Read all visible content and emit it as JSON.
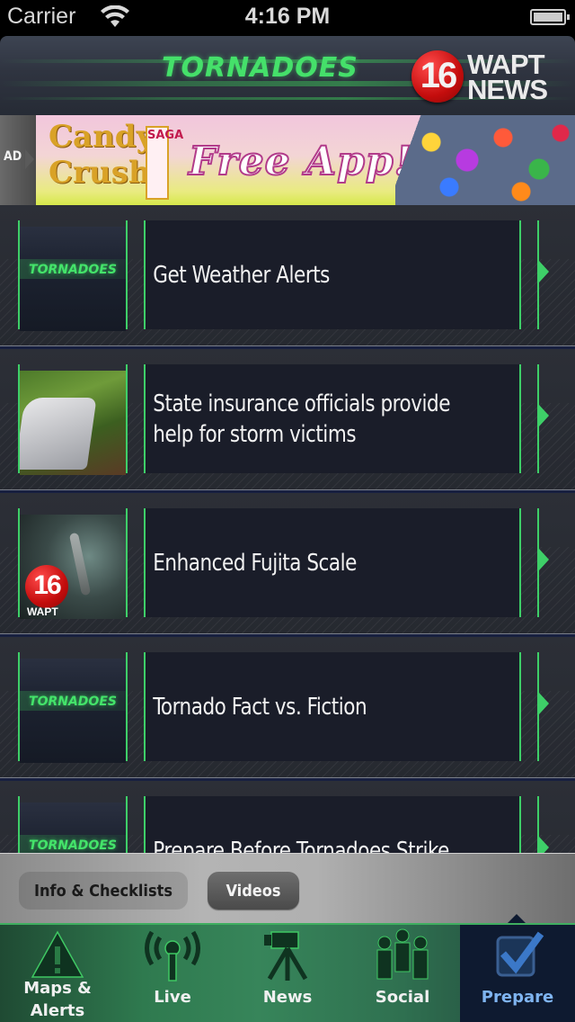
{
  "status_bar": {
    "carrier": "Carrier",
    "time": "4:16 PM",
    "wifi_icon": "wifi-icon",
    "battery_icon": "battery-icon"
  },
  "header": {
    "title": "TORNADOES",
    "logo": {
      "number": "16",
      "line1": "WAPT",
      "line2": "NEWS"
    }
  },
  "ad": {
    "label": "AD",
    "banner": {
      "brand_line1": "Candy",
      "brand_line2": "Crush",
      "saga": "SAGA",
      "headline": "Free App!"
    }
  },
  "list": {
    "items": [
      {
        "title": "Get Weather Alerts",
        "thumbnail": "tornadoes",
        "thumb_text": "TORNADOES"
      },
      {
        "title": "State insurance officials provide help for storm victims",
        "thumbnail": "car-storm-damage"
      },
      {
        "title": "Enhanced Fujita Scale",
        "thumbnail": "wapt-tornado",
        "thumb_badge": "16",
        "thumb_word": "WAPT"
      },
      {
        "title": "Tornado Fact vs. Fiction",
        "thumbnail": "tornadoes",
        "thumb_text": "TORNADOES"
      },
      {
        "title": "Prepare Before Tornadoes Strike",
        "thumbnail": "tornadoes",
        "thumb_text": "TORNADOES"
      }
    ]
  },
  "segments": {
    "options": [
      "Info & Checklists",
      "Videos"
    ],
    "selected": "Videos"
  },
  "tabbar": {
    "items": [
      {
        "label": "Maps & Alerts",
        "icon": "warning-icon"
      },
      {
        "label": "Live",
        "icon": "broadcast-antenna-icon"
      },
      {
        "label": "News",
        "icon": "video-camera-tripod-icon"
      },
      {
        "label": "Social",
        "icon": "people-group-icon"
      },
      {
        "label": "Prepare",
        "icon": "checkbox-check-icon"
      }
    ],
    "selected": "Prepare",
    "colors": {
      "active_bg": "#0e1a30",
      "active_label": "#7fb4f0",
      "accent": "#3ecf68"
    }
  }
}
